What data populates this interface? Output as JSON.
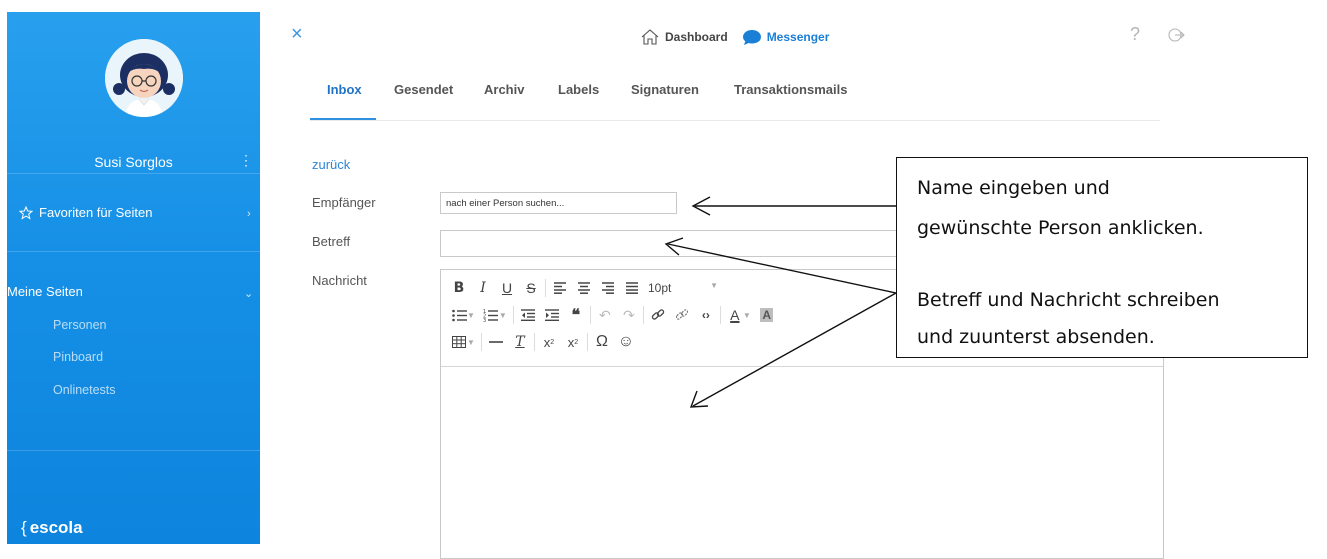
{
  "sidebar": {
    "user_name": "Susi Sorglos",
    "menu_dots": "⋮",
    "favorites_label": "Favoriten für Seiten",
    "my_pages_label": "Meine Seiten",
    "sub_items": [
      "Personen",
      "Pinboard",
      "Onlinetests"
    ],
    "brand": "escola",
    "brand_brace": "{",
    "bg_color": "#1690e6"
  },
  "topbar": {
    "close_icon": "×",
    "dashboard_label": "Dashboard",
    "messenger_label": "Messenger",
    "help_icon": "?",
    "accent_color": "#1a7fd6"
  },
  "tabs": [
    "Inbox",
    "Gesendet",
    "Archiv",
    "Labels",
    "Signaturen",
    "Transaktionsmails"
  ],
  "active_tab": "Inbox",
  "form": {
    "back_link": "zurück",
    "recipient_label": "Empfänger",
    "recipient_placeholder": "nach einer Person suchen...",
    "subject_label": "Betreff",
    "subject_value": "",
    "message_label": "Nachricht",
    "font_size": "10pt"
  },
  "annotation": {
    "line1": "Name eingeben und",
    "line2": "gewünschte Person anklicken.",
    "line3": "Betreff und Nachricht schreiben",
    "line4": "und zuunterst absenden."
  }
}
